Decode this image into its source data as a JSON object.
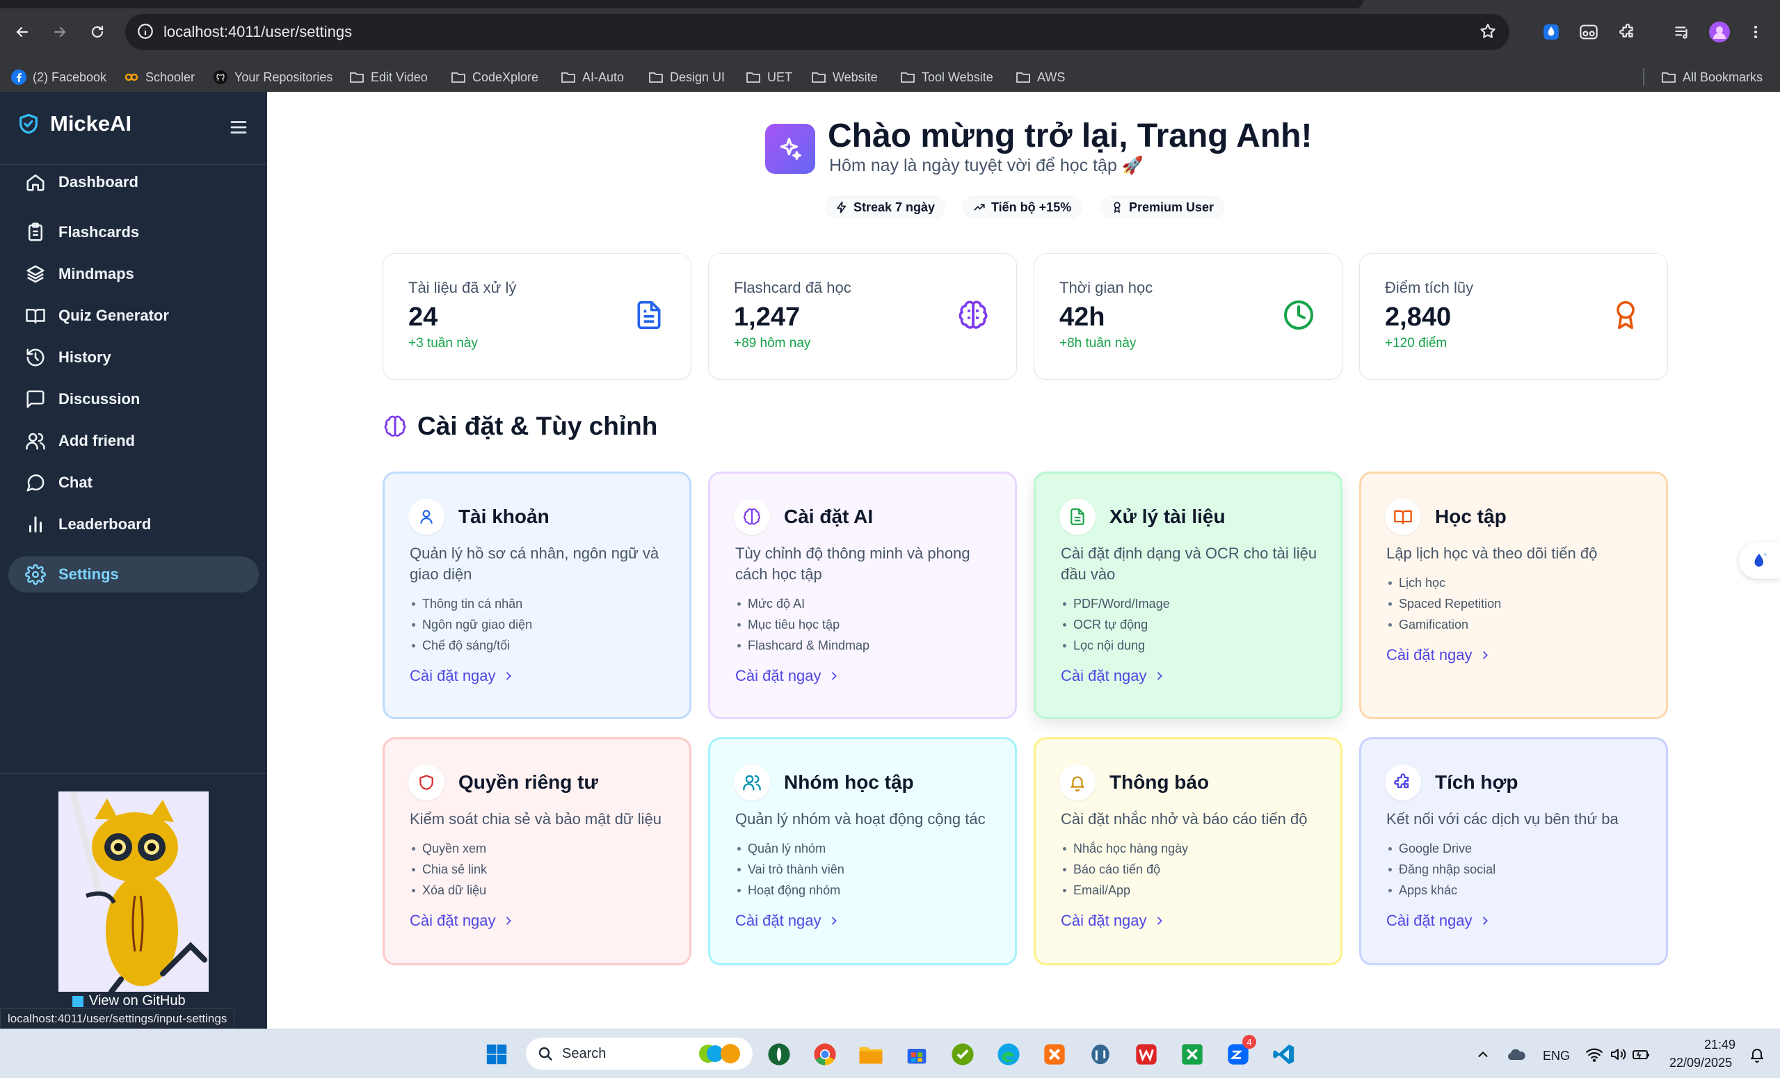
{
  "browser": {
    "url": "localhost:4011/user/settings",
    "bookmarks": [
      {
        "label": "(2) Facebook",
        "icon": "facebook-icon"
      },
      {
        "label": "Schooler",
        "icon": "schooler-icon"
      },
      {
        "label": "Your Repositories",
        "icon": "github-icon"
      },
      {
        "label": "Edit Video",
        "icon": "folder-icon"
      },
      {
        "label": "CodeXplore",
        "icon": "folder-icon"
      },
      {
        "label": "AI-Auto",
        "icon": "folder-icon"
      },
      {
        "label": "Design UI",
        "icon": "folder-icon"
      },
      {
        "label": "UET",
        "icon": "folder-icon"
      },
      {
        "label": "Website",
        "icon": "folder-icon"
      },
      {
        "label": "Tool Website",
        "icon": "folder-icon"
      },
      {
        "label": "AWS",
        "icon": "folder-icon"
      }
    ],
    "all_bookmarks": "All Bookmarks",
    "status_url": "localhost:4011/user/settings/input-settings"
  },
  "sidebar": {
    "brand": "MickeAI",
    "items": [
      {
        "label": "Dashboard",
        "icon": "home-icon"
      },
      {
        "label": "Flashcards",
        "icon": "clipboard-icon"
      },
      {
        "label": "Mindmaps",
        "icon": "layers-icon"
      },
      {
        "label": "Quiz Generator",
        "icon": "book-open-icon"
      },
      {
        "label": "History",
        "icon": "history-icon"
      },
      {
        "label": "Discussion",
        "icon": "message-square-icon"
      },
      {
        "label": "Add friend",
        "icon": "users-icon"
      },
      {
        "label": "Chat",
        "icon": "message-circle-icon"
      },
      {
        "label": "Leaderboard",
        "icon": "bar-chart-icon"
      },
      {
        "label": "Settings",
        "icon": "gear-icon",
        "active": true
      }
    ],
    "github_link": "View on GitHub"
  },
  "hero": {
    "title": "Chào mừng trở lại, Trang Anh!",
    "subtitle": "Hôm nay là ngày tuyệt vời để học tập 🚀",
    "chips": [
      "Streak 7 ngày",
      "Tiến bộ +15%",
      "Premium User"
    ]
  },
  "stats": [
    {
      "label": "Tài liệu đã xử lý",
      "value": "24",
      "delta": "+3 tuần này",
      "icon": "document-icon",
      "color": "#2563eb"
    },
    {
      "label": "Flashcard đã học",
      "value": "1,247",
      "delta": "+89 hôm nay",
      "icon": "brain-icon",
      "color": "#7c3aed"
    },
    {
      "label": "Thời gian học",
      "value": "42h",
      "delta": "+8h tuần này",
      "icon": "clock-icon",
      "color": "#16a34a"
    },
    {
      "label": "Điểm tích lũy",
      "value": "2,840",
      "delta": "+120 điểm",
      "icon": "award-icon",
      "color": "#ea580c"
    }
  ],
  "section_title": "Cài đặt & Tùy chỉnh",
  "cards": [
    {
      "title": "Tài khoản",
      "desc": "Quản lý hồ sơ cá nhân, ngôn ngữ và giao diện",
      "items": [
        "Thông tin cá nhân",
        "Ngôn ngữ giao diện",
        "Chế độ sáng/tối"
      ],
      "link": "Cài đặt ngay",
      "icon": "user-icon",
      "accent": "#2563eb"
    },
    {
      "title": "Cài đặt AI",
      "desc": "Tùy chỉnh độ thông minh và phong cách học tập",
      "items": [
        "Mức độ AI",
        "Mục tiêu học tập",
        "Flashcard & Mindmap"
      ],
      "link": "Cài đặt ngay",
      "icon": "brain-icon",
      "accent": "#7c3aed"
    },
    {
      "title": "Xử lý tài liệu",
      "desc": "Cài đặt định dạng và OCR cho tài liệu đầu vào",
      "items": [
        "PDF/Word/Image",
        "OCR tự động",
        "Lọc nội dung"
      ],
      "link": "Cài đặt ngay",
      "icon": "file-text-icon",
      "accent": "#16a34a"
    },
    {
      "title": "Học tập",
      "desc": "Lập lịch học và theo dõi tiến độ",
      "items": [
        "Lịch học",
        "Spaced Repetition",
        "Gamification"
      ],
      "link": "Cài đặt ngay",
      "icon": "book-open-icon",
      "accent": "#ea580c"
    },
    {
      "title": "Quyền riêng tư",
      "desc": "Kiểm soát chia sẻ và bảo mật dữ liệu",
      "items": [
        "Quyền xem",
        "Chia sẻ link",
        "Xóa dữ liệu"
      ],
      "link": "Cài đặt ngay",
      "icon": "shield-icon",
      "accent": "#dc2626"
    },
    {
      "title": "Nhóm học tập",
      "desc": "Quản lý nhóm và hoạt động cộng tác",
      "items": [
        "Quản lý nhóm",
        "Vai trò thành viên",
        "Hoạt động nhóm"
      ],
      "link": "Cài đặt ngay",
      "icon": "users-icon",
      "accent": "#0891b2"
    },
    {
      "title": "Thông báo",
      "desc": "Cài đặt nhắc nhở và báo cáo tiến độ",
      "items": [
        "Nhắc học hàng ngày",
        "Báo cáo tiến độ",
        "Email/App"
      ],
      "link": "Cài đặt ngay",
      "icon": "bell-icon",
      "accent": "#ca8a04"
    },
    {
      "title": "Tích hợp",
      "desc": "Kết nối với các dịch vụ bên thứ ba",
      "items": [
        "Google Drive",
        "Đăng nhập social",
        "Apps khác"
      ],
      "link": "Cài đặt ngay",
      "icon": "puzzle-icon",
      "accent": "#4f46e5"
    }
  ],
  "taskbar": {
    "search": "Search",
    "lang": "ENG",
    "time": "21:49",
    "date": "22/09/2025",
    "zalo_badge": "4"
  }
}
